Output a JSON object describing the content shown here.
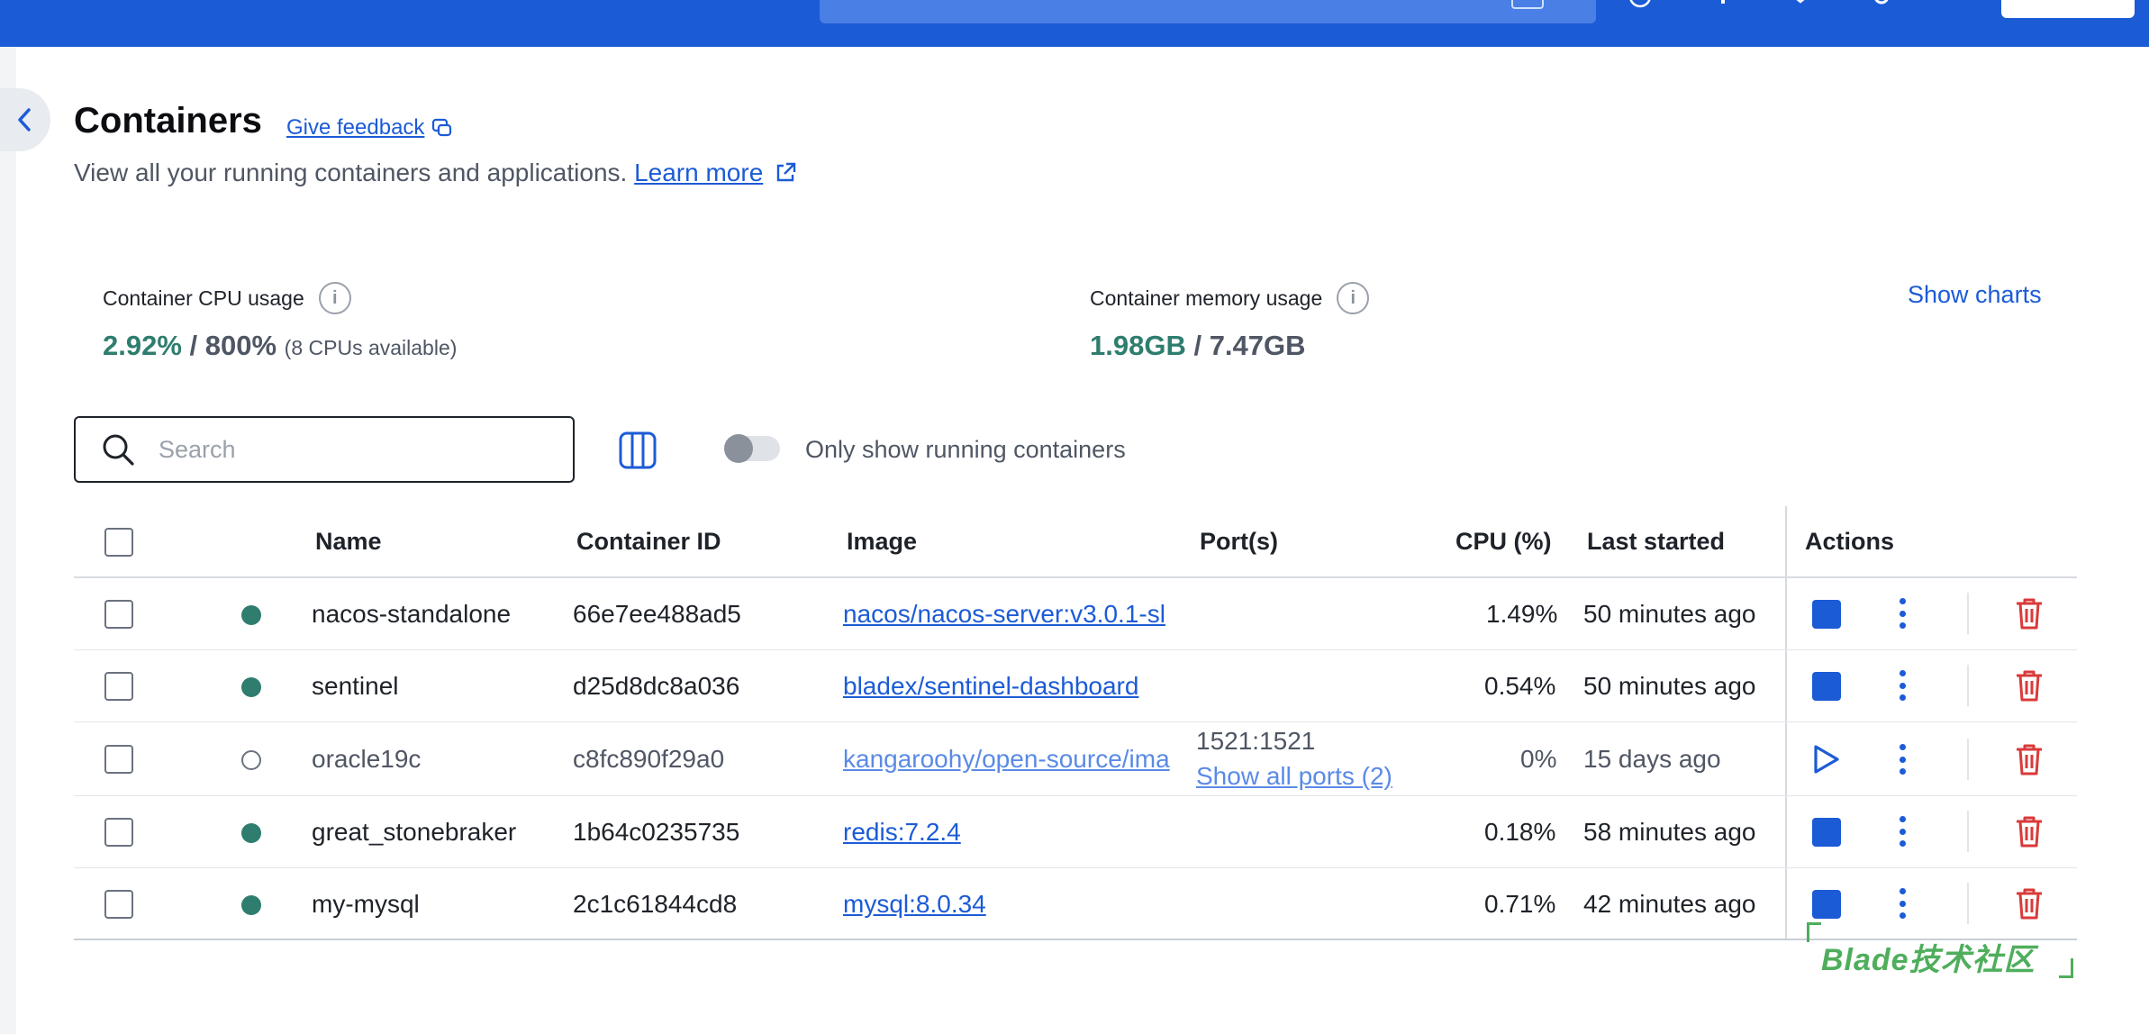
{
  "page": {
    "title": "Containers",
    "feedback_label": "Give feedback",
    "subtitle": "View all your running containers and applications.",
    "learn_more": "Learn more"
  },
  "stats": {
    "cpu": {
      "label": "Container CPU usage",
      "used": "2.92%",
      "separator": " / ",
      "total": "800%",
      "note": "(8 CPUs available)"
    },
    "memory": {
      "label": "Container memory usage",
      "used": "1.98GB",
      "separator": " / ",
      "total": "7.47GB"
    },
    "show_charts": "Show charts"
  },
  "toolbar": {
    "search_placeholder": "Search",
    "only_running_label": "Only show running containers",
    "only_running_on": false
  },
  "table": {
    "headers": {
      "name": "Name",
      "id": "Container ID",
      "image": "Image",
      "ports": "Port(s)",
      "cpu": "CPU (%)",
      "last_started": "Last started",
      "actions": "Actions"
    },
    "rows": [
      {
        "name": "nacos-standalone",
        "id": "66e7ee488ad5",
        "image": "nacos/nacos-server:v3.0.1-sl",
        "port": "",
        "show_ports": "",
        "cpu": "1.49%",
        "last_started": "50 minutes ago",
        "running": true
      },
      {
        "name": "sentinel",
        "id": "d25d8dc8a036",
        "image": "bladex/sentinel-dashboard",
        "port": "",
        "show_ports": "",
        "cpu": "0.54%",
        "last_started": "50 minutes ago",
        "running": true
      },
      {
        "name": "oracle19c",
        "id": "c8fc890f29a0",
        "image": "kangaroohy/open-source/ima",
        "port": "1521:1521",
        "show_ports": "Show all ports (2)",
        "cpu": "0%",
        "last_started": "15 days ago",
        "running": false
      },
      {
        "name": "great_stonebraker",
        "id": "1b64c0235735",
        "image": "redis:7.2.4",
        "port": "",
        "show_ports": "",
        "cpu": "0.18%",
        "last_started": "58 minutes ago",
        "running": true
      },
      {
        "name": "my-mysql",
        "id": "2c1c61844cd8",
        "image": "mysql:8.0.34",
        "port": "",
        "show_ports": "",
        "cpu": "0.71%",
        "last_started": "42 minutes ago",
        "running": true
      }
    ]
  },
  "watermark": "Blade技术社区",
  "colors": {
    "brand": "#1c5bd6",
    "running": "#2e7d6e",
    "delete": "#d93a3a"
  }
}
